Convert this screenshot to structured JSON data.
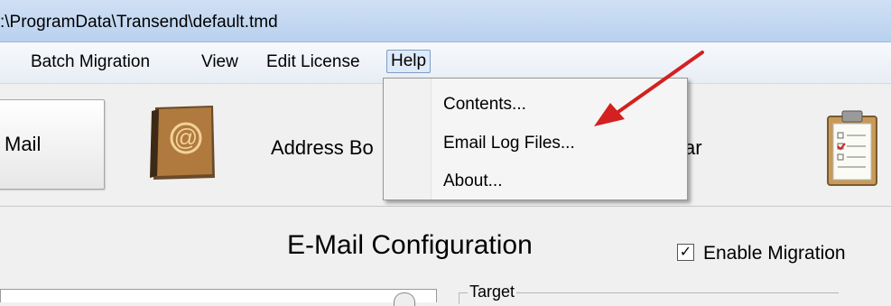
{
  "window": {
    "title": ":\\ProgramData\\Transend\\default.tmd"
  },
  "menubar": {
    "items": [
      {
        "label": "Batch Migration"
      },
      {
        "label": "View"
      },
      {
        "label": "Edit License"
      },
      {
        "label": "Help"
      }
    ],
    "active": "Help"
  },
  "toolbar": {
    "mail_label": "Mail",
    "addressbook_label": "Address Bo",
    "calendar_label": "ar",
    "icons": [
      "address-book-icon",
      "clipboard-icon"
    ]
  },
  "help_menu": {
    "items": [
      {
        "label": "Contents..."
      },
      {
        "label": "Email Log Files..."
      },
      {
        "label": "About..."
      }
    ]
  },
  "annotation": {
    "arrow_color": "#d42020",
    "points_to": "Email Log Files..."
  },
  "config": {
    "heading": "E-Mail Configuration",
    "enable_migration_label": "Enable Migration",
    "enable_migration_checked": true,
    "target_group_label": "Target"
  },
  "colors": {
    "titlebar": "#c4d8f1",
    "menu_highlight": "#dfe9f7",
    "background": "#f0f0f0"
  }
}
